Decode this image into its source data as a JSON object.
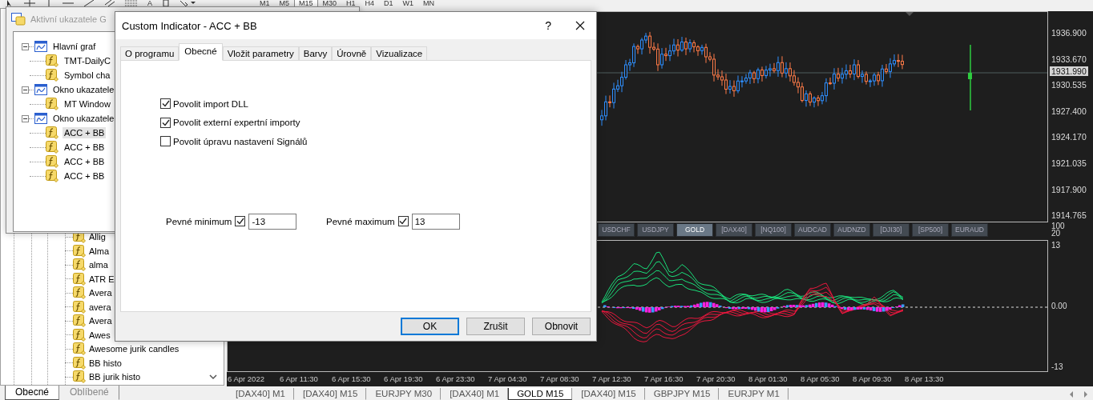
{
  "toolbar": {
    "text_tool": "A",
    "timeframes": [
      {
        "label": "M1",
        "selected": false
      },
      {
        "label": "M5",
        "selected": false
      },
      {
        "label": "M15",
        "selected": true
      },
      {
        "label": "M30",
        "selected": false
      },
      {
        "label": "H1",
        "selected": false
      },
      {
        "label": "H4",
        "selected": false
      },
      {
        "label": "D1",
        "selected": false
      },
      {
        "label": "W1",
        "selected": false
      },
      {
        "label": "MN",
        "selected": false
      }
    ]
  },
  "navigator": {
    "items": [
      "Allig",
      "Alma",
      "alma",
      "ATR E",
      "Avera",
      "avera",
      "Avera",
      "Awes",
      "Awesome jurik candles",
      "BB histo",
      "BB jurik histo"
    ],
    "tabs": [
      {
        "label": "Obecné",
        "selected": true
      },
      {
        "label": "Oblíbené",
        "selected": false
      }
    ]
  },
  "chart": {
    "price_axis": [
      "1936.900",
      "1933.670",
      "1930.535",
      "1927.400",
      "1924.170",
      "1921.035",
      "1917.900",
      "1914.765"
    ],
    "current_price": "1931.990",
    "symbols": [
      {
        "label": "USDCHF",
        "selected": false
      },
      {
        "label": "USDJPY",
        "selected": false
      },
      {
        "label": "GOLD",
        "selected": true
      },
      {
        "label": "[DAX40]",
        "selected": false
      },
      {
        "label": "[NQ100]",
        "selected": false
      },
      {
        "label": "AUDCAD",
        "selected": false
      },
      {
        "label": "AUDNZD",
        "selected": false
      },
      {
        "label": "[DJI30]",
        "selected": false
      },
      {
        "label": "[SP500]",
        "selected": false
      },
      {
        "label": "EURAUD",
        "selected": false
      }
    ],
    "symbol_scale": [
      "100",
      "20"
    ],
    "indicator_axis": [
      "13",
      "0.00",
      "-13"
    ],
    "time_axis": [
      "6 Apr 2022",
      "6 Apr 11:30",
      "6 Apr 15:30",
      "6 Apr 19:30",
      "6 Apr 23:30",
      "7 Apr 04:30",
      "7 Apr 08:30",
      "7 Apr 12:30",
      "7 Apr 16:30",
      "7 Apr 20:30",
      "8 Apr 01:30",
      "8 Apr 05:30",
      "8 Apr 09:30",
      "8 Apr 13:30"
    ]
  },
  "chart_tabs": [
    {
      "label": "[DAX40] M1",
      "selected": false
    },
    {
      "label": "[DAX40] M15",
      "selected": false
    },
    {
      "label": "EURJPY M30",
      "selected": false
    },
    {
      "label": "[DAX40] M1",
      "selected": false
    },
    {
      "label": "GOLD M15",
      "selected": true
    },
    {
      "label": "[DAX40] M15",
      "selected": false
    },
    {
      "label": "GBPJPY M15",
      "selected": false
    },
    {
      "label": "EURJPY M1",
      "selected": false
    }
  ],
  "indicators_window": {
    "title": "Aktivní ukazatele G",
    "tree": [
      {
        "label": "Hlavní graf",
        "expanded": true,
        "children": [
          {
            "label": "TMT-DailyC",
            "selected": false
          },
          {
            "label": "Symbol cha",
            "selected": false
          }
        ]
      },
      {
        "label": "Okno ukazatele",
        "expanded": true,
        "children": [
          {
            "label": "MT Window",
            "selected": false
          }
        ]
      },
      {
        "label": "Okno ukazatele",
        "expanded": true,
        "children": [
          {
            "label": "ACC + BB",
            "selected": true
          },
          {
            "label": "ACC + BB",
            "selected": false
          },
          {
            "label": "ACC + BB",
            "selected": false
          },
          {
            "label": "ACC + BB",
            "selected": false
          }
        ]
      }
    ]
  },
  "dialog": {
    "title": "Custom Indicator - ACC + BB",
    "help": "?",
    "tabs": [
      {
        "label": "O programu",
        "selected": false
      },
      {
        "label": "Obecné",
        "selected": true
      },
      {
        "label": "Vložit parametry",
        "selected": false
      },
      {
        "label": "Barvy",
        "selected": false
      },
      {
        "label": "Úrovně",
        "selected": false
      },
      {
        "label": "Vizualizace",
        "selected": false
      }
    ],
    "options": [
      {
        "label": "Povolit import DLL",
        "checked": true
      },
      {
        "label": "Povolit externí expertní importy",
        "checked": true
      },
      {
        "label": "Povolit úpravu nastavení Signálů",
        "checked": false
      }
    ],
    "fixed_minimum": {
      "label": "Pevné minimum",
      "checked": true,
      "value": "-13"
    },
    "fixed_maximum": {
      "label": "Pevné maximum",
      "checked": true,
      "value": "13"
    },
    "buttons": [
      {
        "label": "OK",
        "default": true
      },
      {
        "label": "Zrušit",
        "default": false
      },
      {
        "label": "Obnovit",
        "default": false
      }
    ]
  }
}
